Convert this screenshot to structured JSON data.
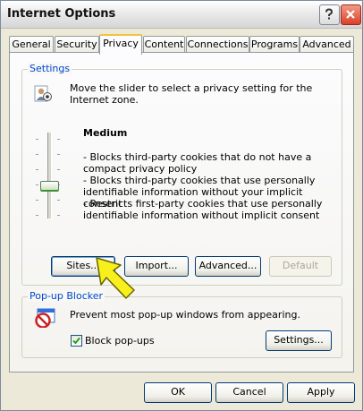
{
  "window": {
    "title": "Internet Options"
  },
  "title_buttons": [
    {
      "icon": "help-icon"
    },
    {
      "icon": "close-icon",
      "color": "#d9412b"
    }
  ],
  "tabs": [
    "General",
    "Security",
    "Privacy",
    "Content",
    "Connections",
    "Programs",
    "Advanced"
  ],
  "active_tab": "Privacy",
  "settings": {
    "group_label": "Settings",
    "intro": "Move the slider to select a privacy setting for the Internet zone.",
    "level": "Medium",
    "slider_position": "third of six notches from the bottom",
    "bullets": [
      "- Blocks third-party cookies that do not have a compact privacy policy",
      "- Blocks third-party cookies that use personally identifiable information without your implicit consent",
      "- Restricts first-party cookies that use personally identifiable information without implicit consent"
    ],
    "buttons": {
      "sites": "Sites...",
      "import": "Import...",
      "advanced": "Advanced...",
      "default": "Default"
    }
  },
  "popup_blocker": {
    "group_label": "Pop-up Blocker",
    "description": "Prevent most pop-up windows from appearing.",
    "checkbox_label": "Block pop-ups",
    "checked": true,
    "settings_button": "Settings..."
  },
  "footer": {
    "ok": "OK",
    "cancel": "Cancel",
    "apply": "Apply"
  },
  "annotation": {
    "icon": "yellow-arrow-icon",
    "color": "#f7f01c",
    "points_to": "Sites..."
  }
}
